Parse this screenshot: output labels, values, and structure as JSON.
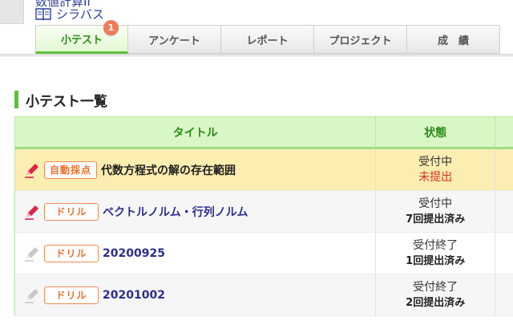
{
  "header": {
    "course_name": "数値計算II",
    "syllabus_label": "シラバス"
  },
  "tabs": [
    {
      "label": "小テスト",
      "active": true,
      "badge": "1"
    },
    {
      "label": "アンケート",
      "active": false,
      "badge": ""
    },
    {
      "label": "レポート",
      "active": false,
      "badge": ""
    },
    {
      "label": "プロジェクト",
      "active": false,
      "badge": ""
    },
    {
      "label": "成　績",
      "active": false,
      "badge": ""
    }
  ],
  "section": {
    "title": "小テスト一覧"
  },
  "table": {
    "columns": [
      "タイトル",
      "状態"
    ],
    "rows": [
      {
        "tag": "自動採点",
        "title": "代数方程式の解の存在範囲",
        "status": "受付中",
        "sub_status": "未提出",
        "sub_style": "red",
        "style": "highlight",
        "pencil": "active"
      },
      {
        "tag": "ドリル",
        "title": "ベクトルノルム・行列ノルム",
        "status": "受付中",
        "sub_status": "7回提出済み",
        "sub_style": "bold",
        "style": "alt",
        "pencil": "active"
      },
      {
        "tag": "ドリル",
        "title": "20200925",
        "status": "受付終了",
        "sub_status": "1回提出済み",
        "sub_style": "bold",
        "style": "plain",
        "pencil": "inactive"
      },
      {
        "tag": "ドリル",
        "title": "20201002",
        "status": "受付終了",
        "sub_status": "2回提出済み",
        "sub_style": "bold",
        "style": "alt",
        "pencil": "inactive"
      }
    ]
  },
  "colors": {
    "accent_green": "#56c234",
    "tag_orange": "#ef6f2e",
    "link_blue": "#2d2d8f",
    "highlight_row": "#fcedb0",
    "pencil_active": "#e0224a",
    "pencil_inactive": "#c8c8c8"
  },
  "icons": {
    "syllabus": "book-icon",
    "pencil": "pencil-icon",
    "avatar": "avatar-placeholder"
  }
}
